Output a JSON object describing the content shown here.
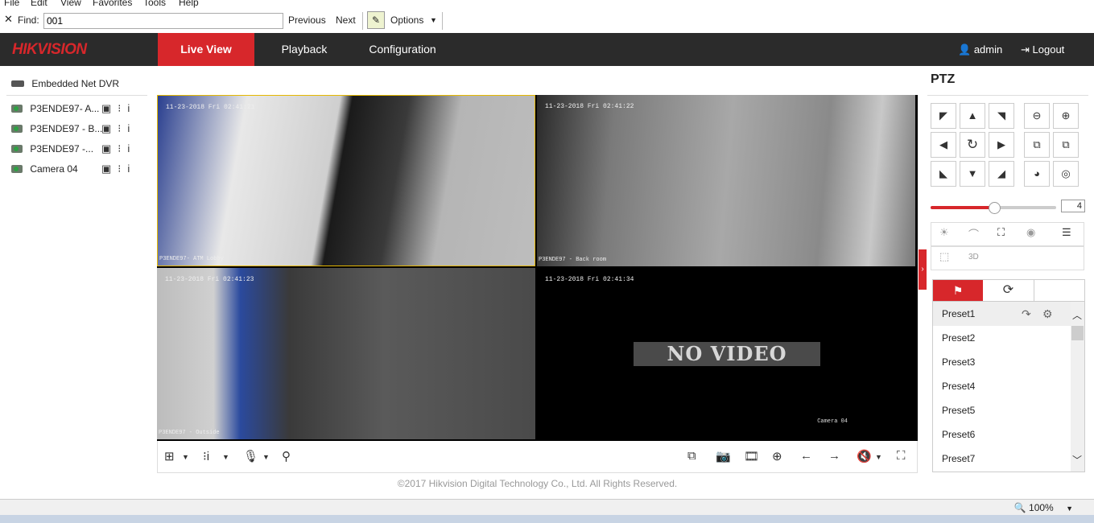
{
  "menu": [
    "File",
    "Edit",
    "View",
    "Favorites",
    "Tools",
    "Help"
  ],
  "findbar": {
    "label": "Find:",
    "value": "001",
    "previous": "Previous",
    "next": "Next",
    "options": "Options"
  },
  "nav": {
    "logo": "HIKVISION",
    "tabs": [
      "Live View",
      "Playback",
      "Configuration"
    ],
    "user": "admin",
    "logout": "Logout"
  },
  "tree": {
    "root": "Embedded Net DVR",
    "cameras": [
      "P3ENDE97- A...",
      "P3ENDE97 - B...",
      "P3ENDE97 -...",
      "Camera 04"
    ]
  },
  "tiles": [
    {
      "timestamp": "11-23-2018 Fri 02:41:21",
      "name": "P3ENDE97- ATM Lobby"
    },
    {
      "timestamp": "11-23-2018 Fri 02:41:22",
      "name": "P3ENDE97 - Back room"
    },
    {
      "timestamp": "11-23-2018 Fri 02:41:23",
      "name": "P3ENDE97 - Outside"
    },
    {
      "timestamp": "11-23-2018 Fri 02:41:34",
      "name": "Camera 04",
      "no_video": "NO VIDEO"
    }
  ],
  "footer": "©2017 Hikvision Digital Technology Co., Ltd. All Rights Reserved.",
  "ptz": {
    "title": "PTZ",
    "speed": "4",
    "speed_fraction": 0.5,
    "presets": [
      "Preset1",
      "Preset2",
      "Preset3",
      "Preset4",
      "Preset5",
      "Preset6",
      "Preset7"
    ]
  },
  "status": {
    "zoom": "100%"
  },
  "colors": {
    "accent": "#d7272b",
    "nav_bg": "#2b2b2b",
    "selected_tile_border": "#e6b800"
  }
}
